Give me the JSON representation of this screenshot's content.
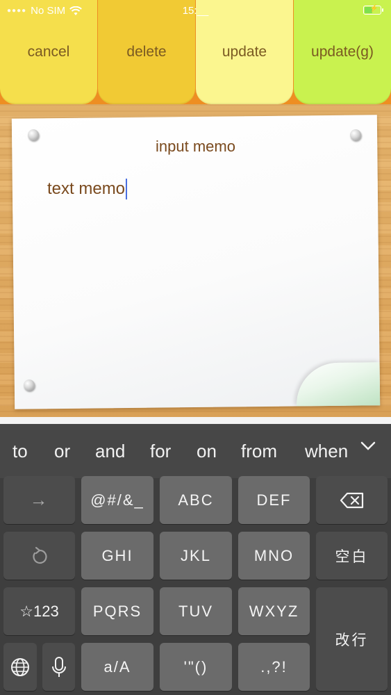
{
  "status_bar": {
    "carrier": "No SIM",
    "time": "15:__",
    "battery_fill": 0.55
  },
  "top_buttons": {
    "cancel": "cancel",
    "delete": "delete",
    "update": "update",
    "update_g": "update(g)"
  },
  "memo": {
    "title": "input memo",
    "text": "text memo"
  },
  "suggestions": [
    "to",
    "or",
    "and",
    "for",
    "on",
    "from",
    "when"
  ],
  "keyboard": {
    "row1": [
      "→",
      "@#/&_",
      "ABC",
      "DEF",
      "⌫"
    ],
    "row2": [
      "↺",
      "GHI",
      "JKL",
      "MNO",
      "空白"
    ],
    "row3": [
      "☆123",
      "PQRS",
      "TUV",
      "WXYZ"
    ],
    "return_key": "改行",
    "row4": [
      "globe",
      "mic",
      "a/A",
      "'\"()",
      ".,?!"
    ]
  },
  "colors": {
    "header_bg": "#ee8e22",
    "cancel_bg": "#f5df4c",
    "delete_bg": "#f1ca34",
    "update_bg": "#fbf68f",
    "update_g_bg": "#c9f24f",
    "memo_text": "#7a4a1e",
    "caret": "#4a6fe0",
    "keyboard_bg": "#3e3e3e",
    "key_bg": "#6b6b6b"
  }
}
